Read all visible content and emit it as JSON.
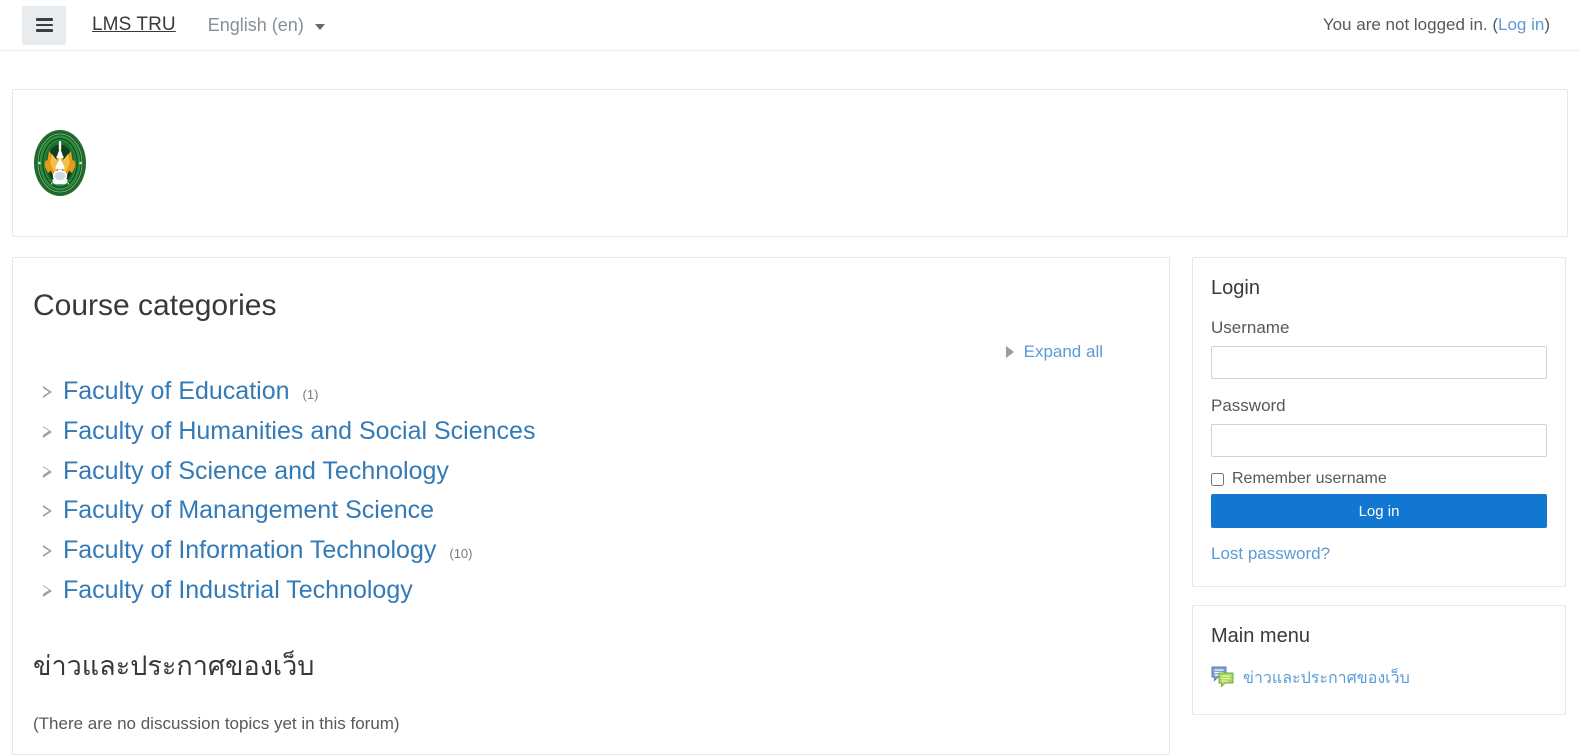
{
  "navbar": {
    "drawer_toggle_name": "Side panel",
    "brand": "LMS TRU",
    "language": "English (en)",
    "login_status": "You are not logged in. (",
    "login_link": "Log in",
    "login_status_end": ")"
  },
  "banner": {
    "logo_alt": "Tepsatri Rajabhat University seal"
  },
  "main": {
    "page_title": "Course categories",
    "expand_all": "Expand all",
    "categories": [
      {
        "label": "Faculty of Education",
        "count": "(1)"
      },
      {
        "label": "Faculty of Humanities and Social Sciences",
        "count": ""
      },
      {
        "label": "Faculty of Science and Technology",
        "count": ""
      },
      {
        "label": "Faculty of Manangement Science",
        "count": ""
      },
      {
        "label": "Faculty of Information Technology",
        "count": "(10)"
      },
      {
        "label": "Faculty of Industrial Technology",
        "count": ""
      }
    ],
    "news_title": "ข่าวและประกาศของเว็บ",
    "forum_empty": "(There are no discussion topics yet in this forum)"
  },
  "login_block": {
    "title": "Login",
    "username_label": "Username",
    "username_value": "",
    "username_placeholder": "",
    "password_label": "Password",
    "password_value": "",
    "password_placeholder": "",
    "remember_label": "Remember username",
    "remember_checked": false,
    "submit_label": "Log in",
    "lost_password": "Lost password?"
  },
  "main_menu_block": {
    "title": "Main menu",
    "items": [
      {
        "label": "ข่าวและประกาศของเว็บ",
        "icon": "forum-icon"
      }
    ]
  },
  "colors": {
    "link": "#337ab7",
    "muted_link": "#5b9bd5",
    "primary_button": "#1177d1",
    "text": "#373a3c",
    "border": "#e4e6e8",
    "toggle_bg": "#e9ecef"
  }
}
